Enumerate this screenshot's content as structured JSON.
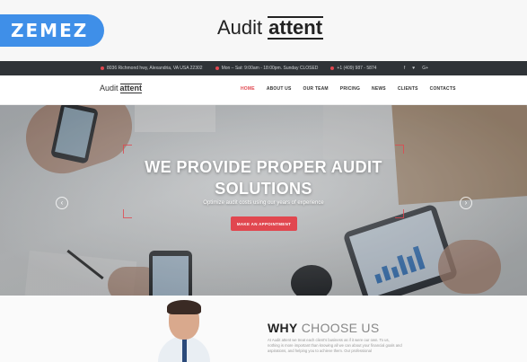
{
  "promo": {
    "vendor_badge": "ZEMEZ",
    "brand_part1": "Audit",
    "brand_part2": "attent"
  },
  "topbar": {
    "address": "8036 Richmond hwy, Alexandria, VA USA 22302",
    "hours": "Mon – Sat: 9:00am - 18:00pm. Sunday CLOSED",
    "phone": "+1 (409) 987 - 5874",
    "social": [
      "f",
      "♥",
      "G+"
    ]
  },
  "nav": {
    "logo_part1": "Audit",
    "logo_part2": "attent",
    "items": [
      {
        "label": "HOME",
        "active": true
      },
      {
        "label": "ABOUT US",
        "active": false
      },
      {
        "label": "OUR TEAM",
        "active": false
      },
      {
        "label": "PRICING",
        "active": false
      },
      {
        "label": "NEWS",
        "active": false
      },
      {
        "label": "CLIENTS",
        "active": false
      },
      {
        "label": "CONTACTS",
        "active": false
      }
    ]
  },
  "hero": {
    "title_line1": "WE PROVIDE PROPER AUDIT",
    "title_line2": "SOLUTIONS",
    "subtitle": "Optimize audit costs using our years of experience",
    "cta": "MAKE AN APPOINTMENT",
    "prev_icon": "‹",
    "next_icon": "›"
  },
  "why": {
    "title_bold": "WHY",
    "title_light": "CHOOSE US",
    "text": "At Audit attent we treat each client's business as if it were our own. To us, nothing is more important than knowing all we can about your financial goals and aspirations, and helping you to achieve them. Our professional"
  },
  "colors": {
    "accent": "#e1474f",
    "badge": "#3f8fe8",
    "topbar": "#2f3337"
  }
}
